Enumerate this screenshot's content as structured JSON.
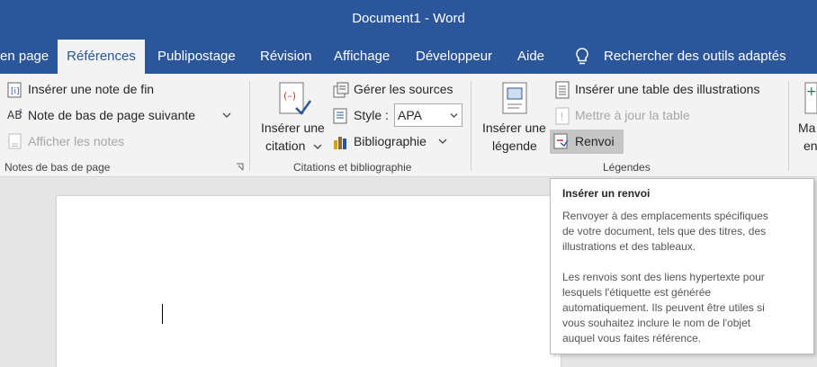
{
  "window": {
    "title": "Document1  -  Word"
  },
  "tabs": [
    {
      "label": "en page"
    },
    {
      "label": "Références",
      "active": true
    },
    {
      "label": "Publipostage"
    },
    {
      "label": "Révision"
    },
    {
      "label": "Affichage"
    },
    {
      "label": "Développeur"
    },
    {
      "label": "Aide"
    }
  ],
  "search": {
    "label": "Rechercher des outils adaptés",
    "icon": "lightbulb-icon"
  },
  "ribbon": {
    "footnotes": {
      "insert_endnote": "Insérer une note de fin",
      "next_footnote": "Note de bas de page suivante",
      "show_notes": "Afficher les notes",
      "group_label": "Notes de bas de page"
    },
    "citations": {
      "insert_citation_line1": "Insérer une",
      "insert_citation_line2": "citation",
      "manage_sources": "Gérer les sources",
      "style_label": "Style :",
      "style_value": "APA",
      "bibliography": "Bibliographie",
      "group_label": "Citations et bibliographie"
    },
    "captions": {
      "insert_caption_line1": "Insérer une",
      "insert_caption_line2": "légende",
      "insert_table_of_figures": "Insérer une table des illustrations",
      "update_table": "Mettre à jour la table",
      "cross_reference": "Renvoi",
      "group_label": "Légendes"
    },
    "index": {
      "label_line1": "Ma",
      "label_line2": "en"
    }
  },
  "tooltip": {
    "title": "Insérer un renvoi",
    "paragraph1": [
      "Renvoyer à des emplacements spécifiques",
      "de votre document, tels que des titres, des",
      "illustrations et des tableaux."
    ],
    "paragraph2": [
      "Les renvois sont des liens hypertexte pour",
      "lesquels l'étiquette est générée",
      "automatiquement. Ils peuvent être utiles si",
      "vous souhaitez inclure le nom de l'objet",
      "auquel vous faites référence."
    ]
  },
  "colors": {
    "accent": "#2b579a",
    "ribbon_bg": "#f3f3f3",
    "hover": "#c6c6c6"
  }
}
